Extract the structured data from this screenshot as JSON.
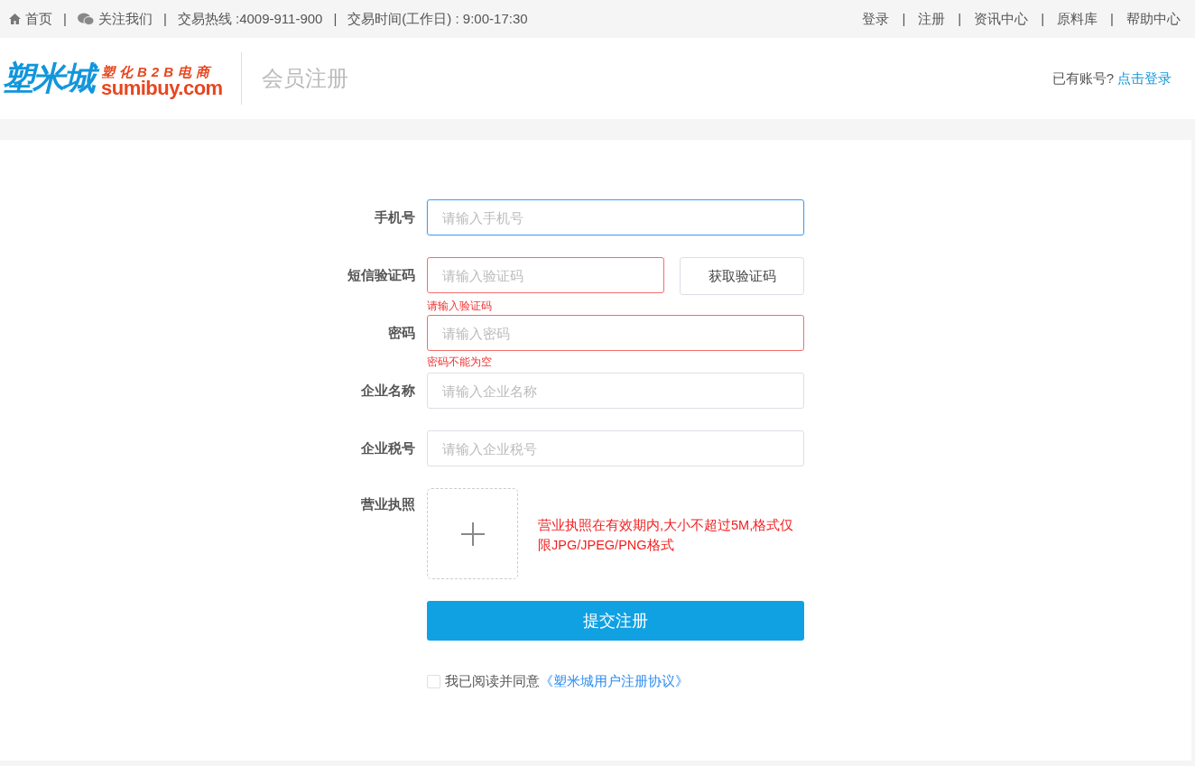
{
  "top_bar": {
    "separator": "|",
    "left": [
      {
        "label": "首页",
        "kind": "home"
      },
      {
        "label": "关注我们",
        "kind": "wechat"
      },
      {
        "label": "交易热线 :4009-911-900",
        "kind": "text"
      },
      {
        "label": "交易时间(工作日) : 9:00-17:30",
        "kind": "text"
      }
    ],
    "right": [
      "登录",
      "注册",
      "资讯中心",
      "原料库",
      "帮助中心"
    ]
  },
  "header": {
    "logo": {
      "name": "塑米城",
      "tagline": "塑化B2B电商",
      "domain": "sumibuy.com"
    },
    "title": "会员注册",
    "login_prompt": "已有账号?",
    "login_link": "点击登录"
  },
  "form": {
    "fields": [
      {
        "label": "手机号",
        "placeholder": "请输入手机号",
        "focused": true,
        "invalid": false
      },
      {
        "label": "短信验证码",
        "placeholder": "请输入验证码",
        "focused": false,
        "invalid": true,
        "error": "请输入验证码",
        "button": "获取验证码"
      },
      {
        "label": "密码",
        "placeholder": "请输入密码",
        "focused": false,
        "invalid": true,
        "error": "密码不能为空"
      },
      {
        "label": "企业名称",
        "placeholder": "请输入企业名称",
        "focused": false,
        "invalid": false
      },
      {
        "label": "企业税号",
        "placeholder": "请输入企业税号",
        "focused": false,
        "invalid": false
      }
    ],
    "upload": {
      "label": "营业执照",
      "hint": "营业执照在有效期内,大小不超过5M,格式仅限JPG/JPEG/PNG格式"
    },
    "submit": "提交注册",
    "agreement": {
      "checked": false,
      "text": "我已阅读并同意",
      "link": "《塑米城用户注册协议》"
    }
  }
}
